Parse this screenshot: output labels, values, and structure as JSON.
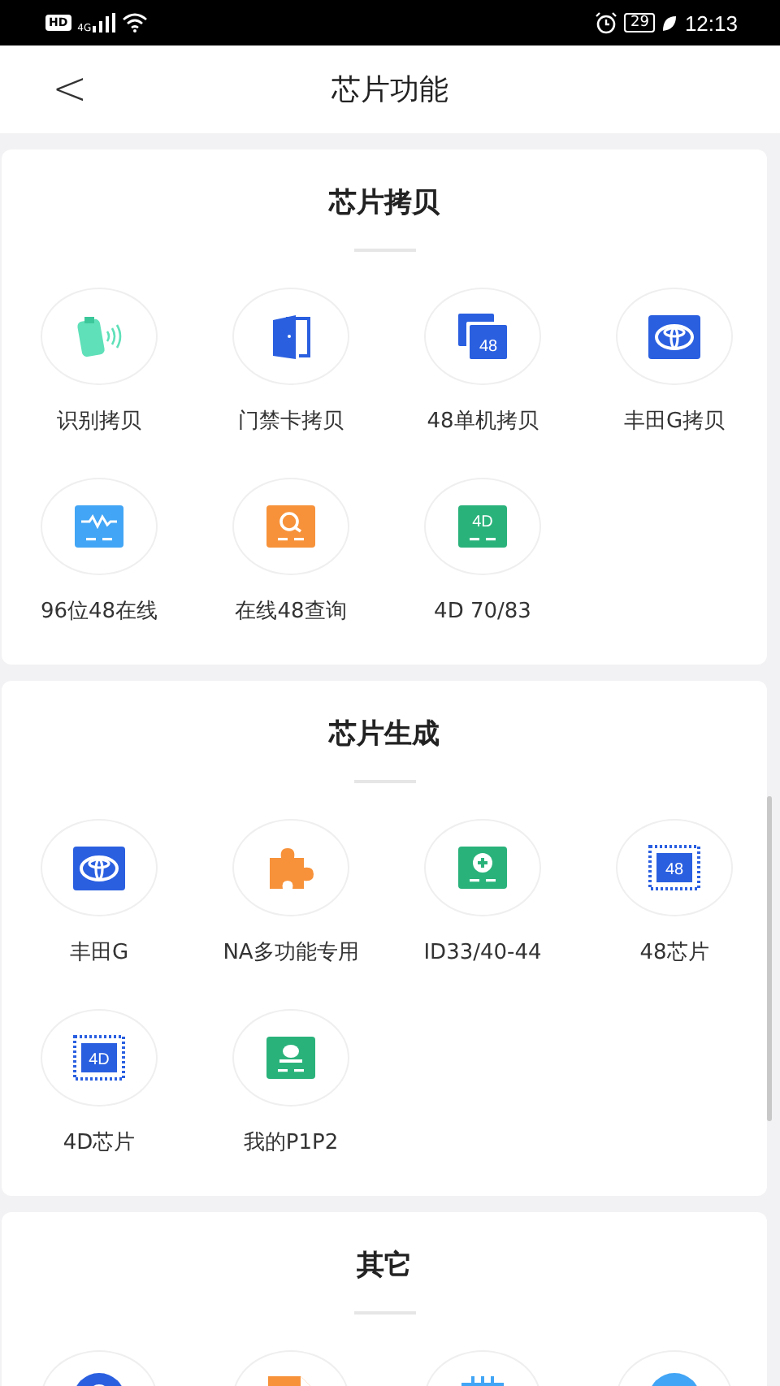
{
  "status_bar": {
    "hd": "HD",
    "network": "4G",
    "battery": "29",
    "time": "12:13"
  },
  "header": {
    "back": "<",
    "title": "芯片功能"
  },
  "sections": [
    {
      "title": "芯片拷贝",
      "items": [
        {
          "kind": "card-wave",
          "label": "识别拷贝"
        },
        {
          "kind": "door",
          "label": "门禁卡拷贝"
        },
        {
          "kind": "stack",
          "badge": "48",
          "label": "48单机拷贝"
        },
        {
          "kind": "emblem",
          "label": "丰田G拷贝"
        },
        {
          "kind": "wave-chip",
          "label": "96位48在线"
        },
        {
          "kind": "search-chip",
          "label": "在线48查询"
        },
        {
          "kind": "text-chip",
          "badge": "4D",
          "label": "4D 70/83"
        }
      ]
    },
    {
      "title": "芯片生成",
      "items": [
        {
          "kind": "emblem",
          "label": "丰田G"
        },
        {
          "kind": "puzzle",
          "label": "NA多功能专用"
        },
        {
          "kind": "plus-chip",
          "label": "ID33/40-44"
        },
        {
          "kind": "dotted-chip",
          "badge": "48",
          "label": "48芯片"
        },
        {
          "kind": "dotted-chip",
          "badge": "4D",
          "label": "4D芯片"
        },
        {
          "kind": "person-chip",
          "label": "我的P1P2"
        }
      ]
    },
    {
      "title": "其它",
      "items": [
        {
          "kind": "blue-round"
        },
        {
          "kind": "orange-doc"
        },
        {
          "kind": "chip-outline"
        },
        {
          "kind": "sky-round"
        }
      ]
    }
  ]
}
